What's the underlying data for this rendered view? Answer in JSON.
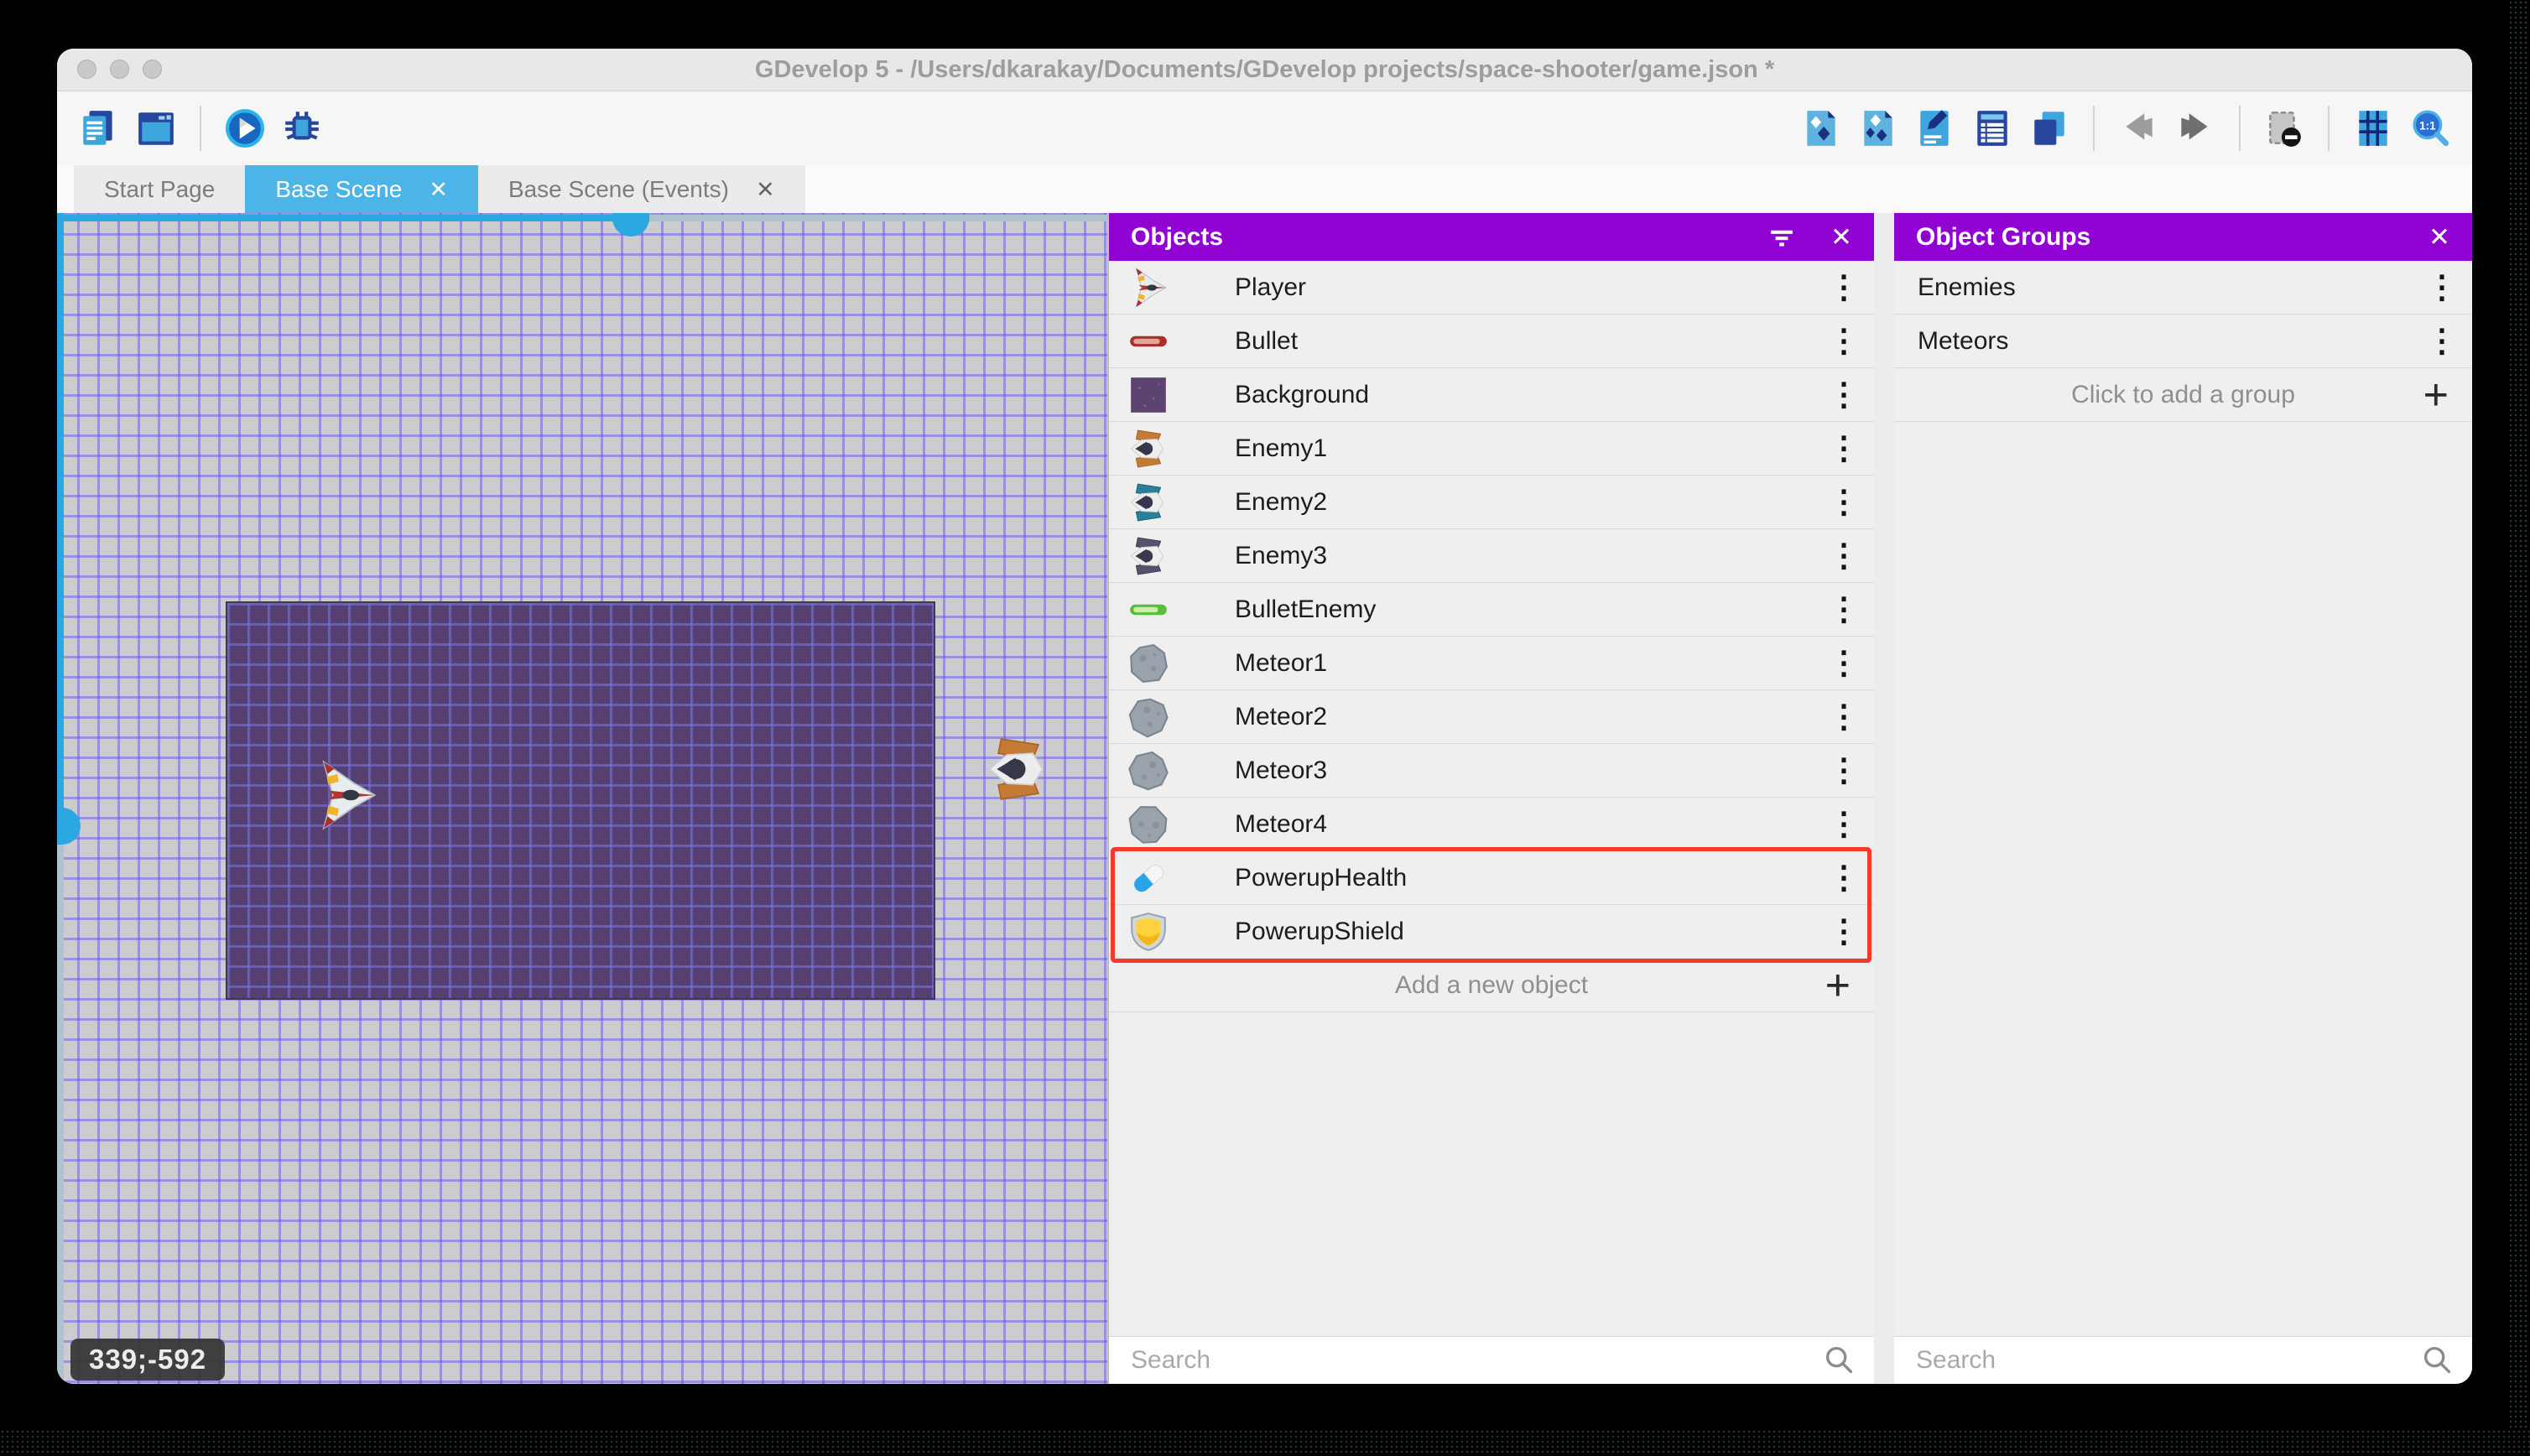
{
  "window": {
    "title": "GDevelop 5 - /Users/dkarakay/Documents/GDevelop projects/space-shooter/game.json *"
  },
  "toolbar": {
    "left": [
      {
        "name": "project-manager-button",
        "icon": "project-manager-icon"
      },
      {
        "name": "scene-editor-button",
        "icon": "scene-window-icon"
      },
      {
        "separator": true
      },
      {
        "name": "play-button",
        "icon": "play-icon"
      },
      {
        "name": "debug-button",
        "icon": "debug-icon"
      }
    ],
    "right": [
      {
        "name": "open-objects-panel-button",
        "icon": "objects-icon"
      },
      {
        "name": "open-object-groups-button",
        "icon": "object-groups-icon"
      },
      {
        "name": "open-properties-button",
        "icon": "properties-icon"
      },
      {
        "name": "open-instances-list-button",
        "icon": "instances-list-icon"
      },
      {
        "name": "open-layers-button",
        "icon": "layers-icon"
      },
      {
        "separator": true
      },
      {
        "name": "undo-button",
        "icon": "undo-icon"
      },
      {
        "name": "redo-button",
        "icon": "redo-icon"
      },
      {
        "separator": true
      },
      {
        "name": "render-options-button",
        "icon": "render-options-icon"
      },
      {
        "separator": true
      },
      {
        "name": "toggle-grid-button",
        "icon": "grid-icon"
      },
      {
        "name": "zoom-original-button",
        "icon": "zoom-1-1-icon"
      }
    ]
  },
  "tabs": [
    {
      "label": "Start Page",
      "active": false,
      "closable": false
    },
    {
      "label": "Base Scene",
      "active": true,
      "closable": true
    },
    {
      "label": "Base Scene (Events)",
      "active": false,
      "closable": true
    }
  ],
  "canvas": {
    "coordinates": "339;-592"
  },
  "objects_panel": {
    "title": "Objects",
    "items": [
      {
        "label": "Player",
        "icon": "player-sprite-icon"
      },
      {
        "label": "Bullet",
        "icon": "bullet-red-icon"
      },
      {
        "label": "Background",
        "icon": "background-swatch-icon"
      },
      {
        "label": "Enemy1",
        "icon": "enemy1-sprite-icon"
      },
      {
        "label": "Enemy2",
        "icon": "enemy2-sprite-icon"
      },
      {
        "label": "Enemy3",
        "icon": "enemy3-sprite-icon"
      },
      {
        "label": "BulletEnemy",
        "icon": "bullet-green-icon"
      },
      {
        "label": "Meteor1",
        "icon": "meteor-rock-icon"
      },
      {
        "label": "Meteor2",
        "icon": "meteor-rock-icon"
      },
      {
        "label": "Meteor3",
        "icon": "meteor-rock-icon"
      },
      {
        "label": "Meteor4",
        "icon": "meteor-rock-icon"
      },
      {
        "label": "PowerupHealth",
        "icon": "health-pill-icon"
      },
      {
        "label": "PowerupShield",
        "icon": "shield-icon"
      }
    ],
    "highlight": {
      "start": 11,
      "end": 12,
      "color": "#f5392c"
    },
    "add_label": "Add a new object",
    "search_placeholder": "Search"
  },
  "groups_panel": {
    "title": "Object Groups",
    "items": [
      {
        "label": "Enemies"
      },
      {
        "label": "Meteors"
      }
    ],
    "add_label": "Click to add a group",
    "search_placeholder": "Search"
  },
  "glyphs": {
    "close": "✕",
    "menu": "⋮",
    "plus": "+"
  },
  "colors": {
    "panel_header_purple": "#9103d2",
    "active_tab_blue": "#4db4e7",
    "highlight_red": "#f5392c",
    "scroll_blue": "#2ba7e2",
    "background_instance": "#564070"
  }
}
